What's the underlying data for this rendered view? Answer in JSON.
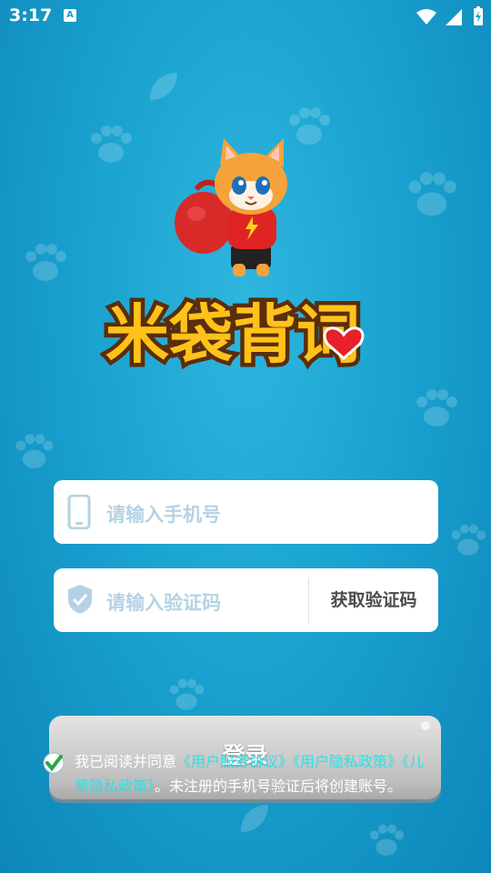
{
  "status_bar": {
    "time": "3:17",
    "badge": "A",
    "icons": [
      "wifi-icon",
      "signal-icon",
      "battery-charging-icon"
    ]
  },
  "app": {
    "title": "米袋背词"
  },
  "login": {
    "phone_placeholder": "请输入手机号",
    "code_placeholder": "请输入验证码",
    "get_code_label": "获取验证码",
    "login_label": "登录"
  },
  "agreement": {
    "prefix": "我已阅读并同意",
    "terms": "《用户服务协议》",
    "privacy": "《用户隐私政策》",
    "children": "《儿童隐私政策》",
    "suffix": "。未注册的手机号验证后将创建账号。"
  },
  "colors": {
    "background": "#1aa2d0",
    "link": "#2ee0e6",
    "check": "#2aa748"
  }
}
